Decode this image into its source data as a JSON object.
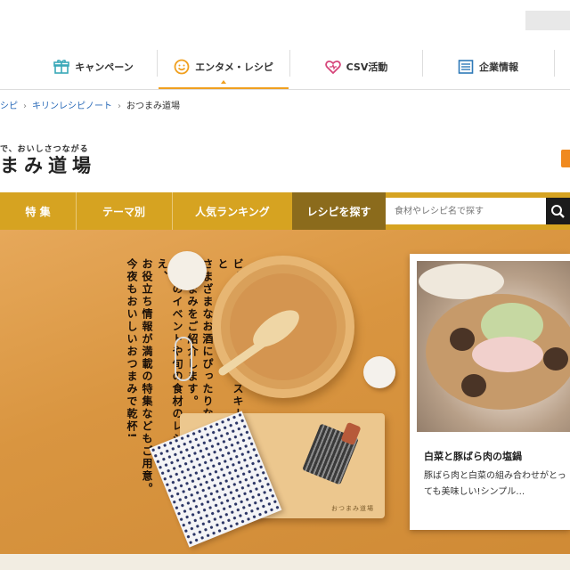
{
  "global_nav": {
    "items": [
      {
        "label": "キャンペーン",
        "icon": "gift-icon"
      },
      {
        "label": "エンタメ・レシピ",
        "icon": "smile-icon"
      },
      {
        "label": "CSV活動",
        "icon": "heart-icon"
      },
      {
        "label": "企業情報",
        "icon": "building-icon"
      }
    ],
    "active": 1
  },
  "breadcrumb": [
    "シピ",
    "キリンレシピノート",
    "おつまみ道場"
  ],
  "header": {
    "tagline": "で、おいしさつながる",
    "site_name": "まみ道場"
  },
  "sub_nav": {
    "tabs": [
      "特 集",
      "テーマ別",
      "人気ランキング"
    ],
    "search_tab": "レシピを探す",
    "search_placeholder": "食材やレシピ名で探す"
  },
  "hero": {
    "lines": [
      "ビール、ワイン、ウイスキー、焼酎・・・と",
      "さまざまなお酒にぴったりな",
      "おつまみをご紹介します。",
      "季節のイベントや旬の食材のレシピに加え、",
      "お役立ち情報が満載の特集などもご用意。",
      "今夜もおいしいおつまみで乾杯!"
    ],
    "board_label": "おつまみ道場"
  },
  "featured": {
    "title": "白菜と豚ばら肉の塩鍋",
    "description": "豚ばら肉と白菜の組み合わせがとっても美味しい!シンプル…"
  },
  "colors": {
    "accent": "#d6a321",
    "search_tab": "#8b6b1c",
    "link": "#2a6ab8"
  }
}
